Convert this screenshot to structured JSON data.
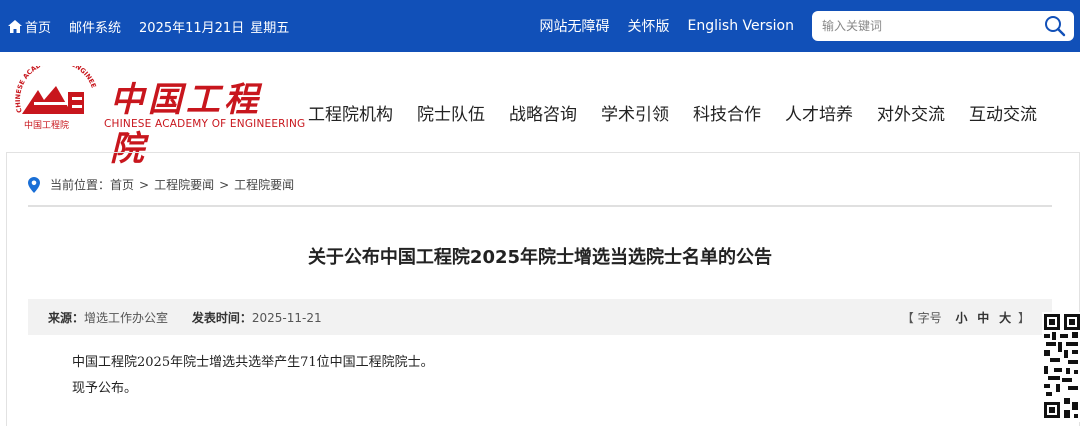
{
  "topbar": {
    "home": "首页",
    "mail": "邮件系统",
    "date": "2025年11月21日",
    "weekday": "星期五",
    "accessibility": "网站无障碍",
    "care_mode": "关怀版",
    "english": "English Version",
    "search_placeholder": "输入关键词"
  },
  "logo": {
    "seal_text": "CHINESE ACADEMY OF ENGINEERING",
    "seal_bottom": "中国工程院",
    "name_cn": "中国工程院",
    "name_en": "CHINESE ACADEMY OF ENGINEERING"
  },
  "nav": {
    "items": [
      "工程院机构",
      "院士队伍",
      "战略咨询",
      "学术引领",
      "科技合作",
      "人才培养",
      "对外交流",
      "互动交流"
    ]
  },
  "breadcrumb": {
    "prefix": "当前位置：",
    "items": [
      "首页",
      "工程院要闻",
      "工程院要闻"
    ],
    "separator": ">"
  },
  "article": {
    "title": "关于公布中国工程院2025年院士增选当选院士名单的公告",
    "source_label": "来源：",
    "source": "增选工作办公室",
    "date_label": "发表时间：",
    "date": "2025-11-21",
    "font_bracket_open": "【",
    "font_label": "字号",
    "font_sizes": [
      "小",
      "中",
      "大"
    ],
    "font_bracket_close": "】",
    "paragraphs": [
      "中国工程院2025年院士增选共选举产生71位中国工程院院士。",
      "现予公布。"
    ]
  },
  "colors": {
    "brand_blue": "#1150b8",
    "brand_red": "#c8161d"
  }
}
